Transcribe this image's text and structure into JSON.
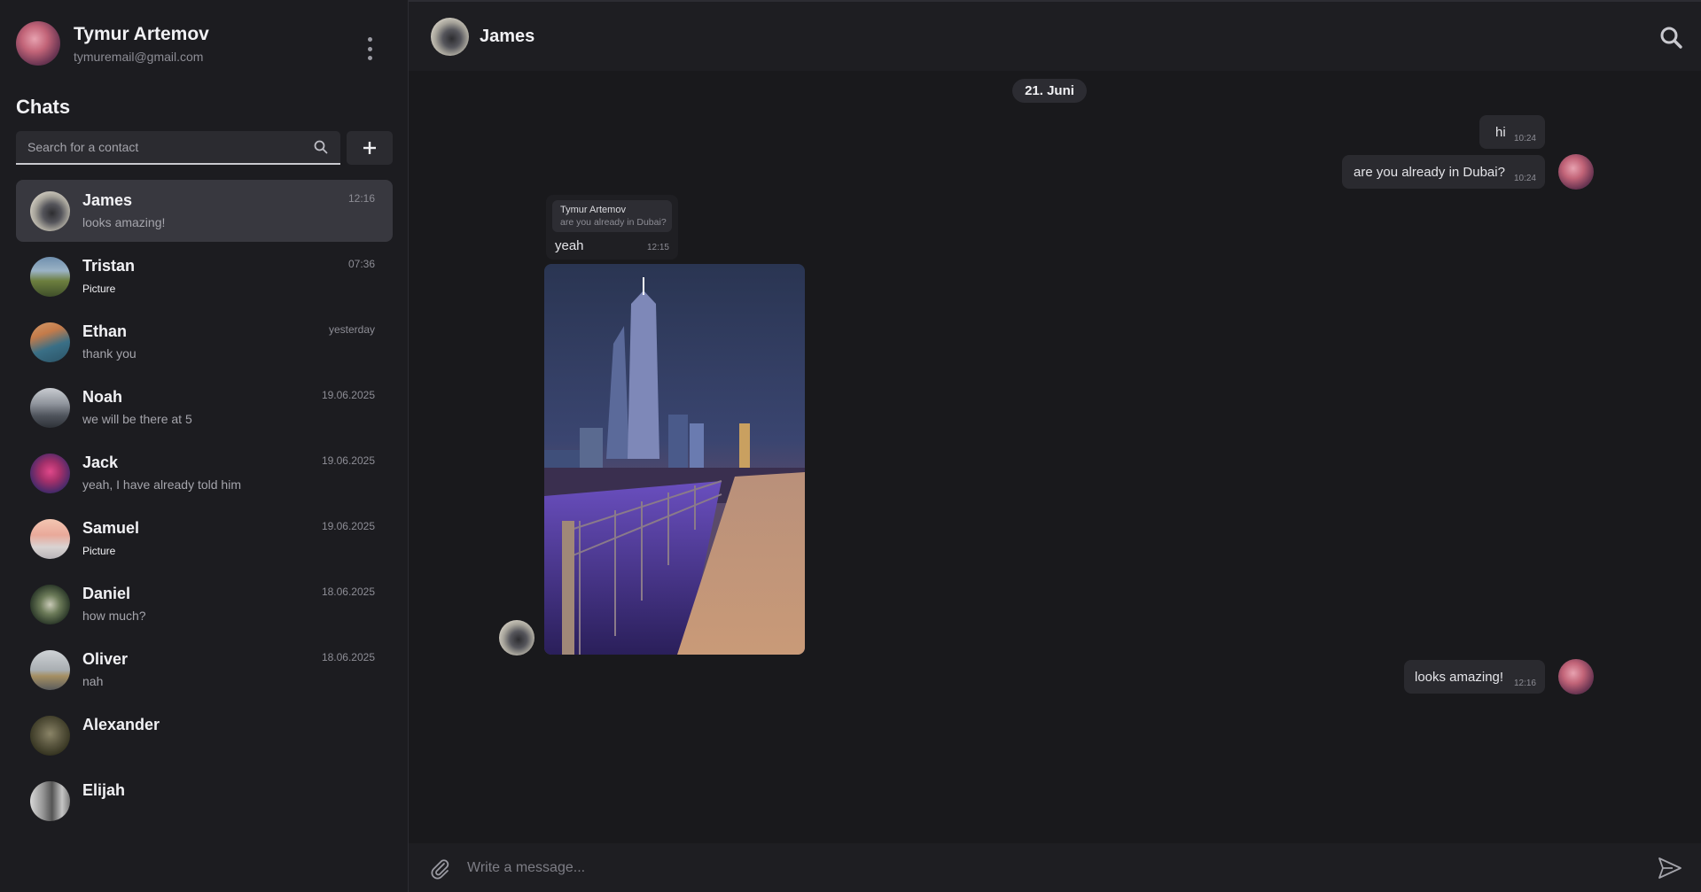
{
  "profile": {
    "name": "Tymur Artemov",
    "email": "tymuremail@gmail.com"
  },
  "sidebar": {
    "title": "Chats",
    "search_placeholder": "Search for a contact",
    "chats": [
      {
        "name": "James",
        "preview": "looks amazing!",
        "time": "12:16",
        "active": true
      },
      {
        "name": "Tristan",
        "preview": "Picture",
        "time": "07:36"
      },
      {
        "name": "Ethan",
        "preview": "thank you",
        "time": "yesterday"
      },
      {
        "name": "Noah",
        "preview": "we will be there at 5",
        "time": "19.06.2025"
      },
      {
        "name": "Jack",
        "preview": "yeah, I have already told him",
        "time": "19.06.2025"
      },
      {
        "name": "Samuel",
        "preview": "Picture",
        "time": "19.06.2025"
      },
      {
        "name": "Daniel",
        "preview": "how much?",
        "time": "18.06.2025"
      },
      {
        "name": "Oliver",
        "preview": "nah",
        "time": "18.06.2025"
      },
      {
        "name": "Alexander",
        "preview": "",
        "time": ""
      },
      {
        "name": "Elijah",
        "preview": "",
        "time": ""
      }
    ]
  },
  "conversation": {
    "contact_name": "James",
    "date_separator": "21. Juni",
    "messages": {
      "hi": {
        "text": "hi",
        "time": "10:24"
      },
      "dubai": {
        "text": "are you already in Dubai?",
        "time": "10:24"
      },
      "yeah": {
        "reply_author": "Tymur Artemov",
        "reply_text": "are you already in Dubai?",
        "text": "yeah",
        "time": "12:15"
      },
      "amazing": {
        "text": "looks amazing!",
        "time": "12:16"
      }
    }
  },
  "composer": {
    "placeholder": "Write a message..."
  },
  "icons": {
    "search": "search-icon",
    "menu": "kebab-menu-icon",
    "add": "plus-icon",
    "attach": "paperclip-icon",
    "send": "send-icon"
  },
  "colors": {
    "sidebar_bg": "#1c1c20",
    "main_bg": "#19191c",
    "bubble_bg": "#2a2a2f",
    "active_chat_bg": "#38383f"
  }
}
